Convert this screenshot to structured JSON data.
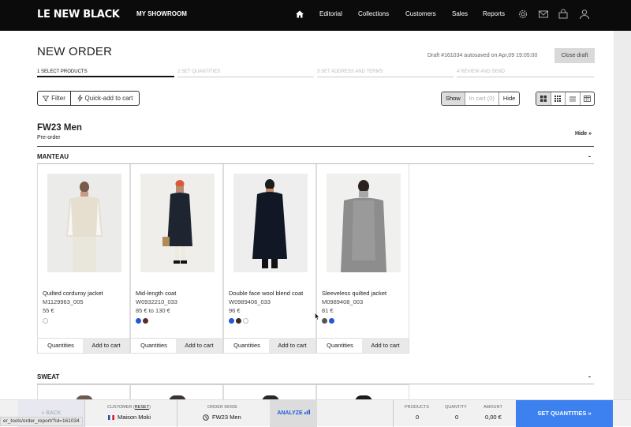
{
  "brand": {
    "logo": "LE NEW BLACK",
    "showroom": "MY SHOWROOM"
  },
  "nav": {
    "editorial": "Editorial",
    "collections": "Collections",
    "customers": "Customers",
    "sales": "Sales",
    "reports": "Reports"
  },
  "page": {
    "title": "NEW ORDER",
    "draft_status": "Draft #161034 autosaved on Apr,09 19:05:00",
    "close_draft": "Close draft"
  },
  "steps": [
    {
      "label": "1 SELECT PRODUCTS",
      "active": true
    },
    {
      "label": "2 SET QUANTITIES",
      "active": false
    },
    {
      "label": "3 SET ADDRESS AND TERMS",
      "active": false
    },
    {
      "label": "4 REVIEW AND SEND",
      "active": false
    }
  ],
  "toolbar": {
    "filter": "Filter",
    "quick_add": "Quick-add to cart",
    "show": "Show",
    "in_cart": "In cart (0)",
    "hide": "Hide",
    "view_modes": [
      "grid-large-icon",
      "grid-small-icon",
      "list-icon",
      "table-icon"
    ],
    "active_view": "grid-large-icon"
  },
  "season": {
    "name": "FW23 Men",
    "type": "Pre-order",
    "hide": "Hide »"
  },
  "categories": [
    {
      "name": "MANTEAU",
      "toggle": "-"
    },
    {
      "name": "SWEAT",
      "toggle": "-"
    }
  ],
  "products": [
    {
      "name": "Quilted corduroy jacket",
      "sku": "M1129963_005",
      "price": "55 €",
      "swatches": [
        "#ffffff"
      ],
      "qty_label": "Quantities",
      "add_label": "Add to cart"
    },
    {
      "name": "Mid-length coat",
      "sku": "W0932210_033",
      "price": "85 € to 130 €",
      "swatches": [
        "#2357d6",
        "#5a2f2a"
      ],
      "qty_label": "Quantities",
      "add_label": "Add to cart"
    },
    {
      "name": "Double face wool blend coat",
      "sku": "W0989406_033",
      "price": "96 €",
      "swatches": [
        "#2357d6",
        "#3a2c2a",
        "#ffffff"
      ],
      "qty_label": "Quantities",
      "add_label": "Add to cart"
    },
    {
      "name": "Sleeveless quilted jacket",
      "sku": "M0989408_003",
      "price": "81 €",
      "swatches": [
        "#555555",
        "#2357d6"
      ],
      "qty_label": "Quantities",
      "add_label": "Add to cart"
    }
  ],
  "bottom": {
    "back": "« BACK",
    "customer_label": "CUSTOMER",
    "reset": "RESET",
    "customer_name": "Maison Moki",
    "order_mode_label": "ORDER MODE",
    "order_mode": "FW23 Men",
    "analyze": "ANALYZE",
    "products_label": "PRODUCTS",
    "products_value": "0",
    "quantity_label": "QUANTITY",
    "quantity_value": "0",
    "amount_label": "AMOUNT",
    "amount_value": "0,00 €",
    "set_quantities": "SET QUANTITIES »"
  },
  "status_url": "er_tools/order_report/?id=161034",
  "colors": {
    "accent": "#3d80f0",
    "topbar": "#0b0b0b"
  }
}
